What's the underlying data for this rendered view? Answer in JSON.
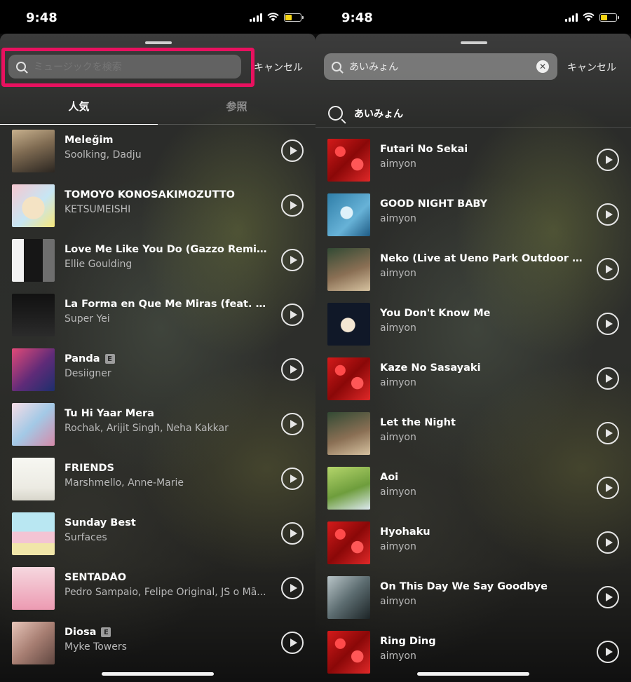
{
  "status": {
    "time": "9:48"
  },
  "left": {
    "search": {
      "placeholder": "ミュージックを検索"
    },
    "cancel_label": "キャンセル",
    "tabs": [
      {
        "label": "人気"
      },
      {
        "label": "参照"
      }
    ],
    "tracks": [
      {
        "title": "Meleğim",
        "artist": "Soolking, Dadju",
        "art": "melegim",
        "explicit": false
      },
      {
        "title": "TOMOYO KONOSAKIMOZUTTO",
        "artist": "KETSUMEISHI",
        "art": "crayon",
        "explicit": false
      },
      {
        "title": "Love Me Like You Do (Gazzo Remix) (Fr...",
        "artist": "Ellie Goulding",
        "art": "ellie",
        "explicit": false
      },
      {
        "title": "La Forma en Que Me Miras (feat. Sam...",
        "artist": "Super Yei",
        "art": "laforma",
        "explicit": false
      },
      {
        "title": "Panda",
        "artist": "Desiigner",
        "art": "panda",
        "explicit": true,
        "explicit_label": "E"
      },
      {
        "title": "Tu Hi Yaar Mera",
        "artist": "Rochak, Arijit Singh, Neha Kakkar",
        "art": "tuhi",
        "explicit": false
      },
      {
        "title": "FRIENDS",
        "artist": "Marshmello, Anne-Marie",
        "art": "friends",
        "explicit": false
      },
      {
        "title": "Sunday Best",
        "artist": "Surfaces",
        "art": "sunday",
        "explicit": false
      },
      {
        "title": "SENTADÃO",
        "artist": "Pedro Sampaio, Felipe Original, JS o Mã...",
        "art": "sentadao",
        "explicit": false
      },
      {
        "title": "Diosa",
        "artist": "Myke Towers",
        "art": "diosa",
        "explicit": true,
        "explicit_label": "E"
      }
    ]
  },
  "right": {
    "search": {
      "value": "あいみょん"
    },
    "cancel_label": "キャンセル",
    "query_suggestion": "あいみょん",
    "tracks": [
      {
        "title": "Futari No Sekai",
        "artist": "aimyon",
        "art": "red"
      },
      {
        "title": "GOOD NIGHT BABY",
        "artist": "aimyon",
        "art": "night"
      },
      {
        "title": "Neko (Live at Ueno Park Outdoor Stag...",
        "artist": "aimyon",
        "art": "neko"
      },
      {
        "title": "You Don't Know Me",
        "artist": "aimyon",
        "art": "moon"
      },
      {
        "title": "Kaze No Sasayaki",
        "artist": "aimyon",
        "art": "red"
      },
      {
        "title": "Let the Night",
        "artist": "aimyon",
        "art": "neko"
      },
      {
        "title": "Aoi",
        "artist": "aimyon",
        "art": "aoi"
      },
      {
        "title": "Hyohaku",
        "artist": "aimyon",
        "art": "red"
      },
      {
        "title": "On This Day We Say Goodbye",
        "artist": "aimyon",
        "art": "goodbye"
      },
      {
        "title": "Ring Ding",
        "artist": "aimyon",
        "art": "red"
      }
    ]
  },
  "colors": {
    "highlight": "#e8115f",
    "battery": "#f5d515"
  }
}
